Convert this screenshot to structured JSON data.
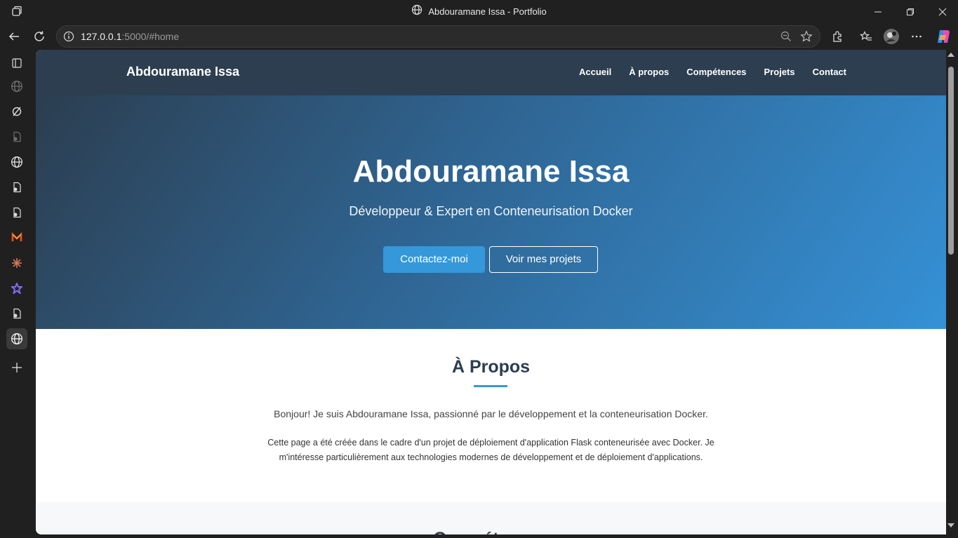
{
  "window": {
    "title": "Abdouramane Issa - Portfolio"
  },
  "browser": {
    "url_host": "127.0.0.1",
    "url_rest": ":5000/#home"
  },
  "site": {
    "brand": "Abdouramane Issa",
    "nav": [
      "Accueil",
      "À propos",
      "Compétences",
      "Projets",
      "Contact"
    ]
  },
  "hero": {
    "title": "Abdouramane Issa",
    "subtitle": "Développeur & Expert en Conteneurisation Docker",
    "primary_button": "Contactez-moi",
    "secondary_button": "Voir mes projets"
  },
  "about": {
    "heading": "À Propos",
    "lead": "Bonjour! Je suis Abdouramane Issa, passionné par le développement et la conteneurisation Docker.",
    "body": "Cette page a été créée dans le cadre d'un projet de déploiement d'application Flask conteneurisée avec Docker. Je m'intéresse particulièrement aux technologies modernes de développement et de déploiement d'applications."
  },
  "skills": {
    "heading": "Compétences"
  },
  "colors": {
    "nav_bg": "#2c3e50",
    "accent": "#3498db",
    "hero_end": "#3591d6"
  }
}
